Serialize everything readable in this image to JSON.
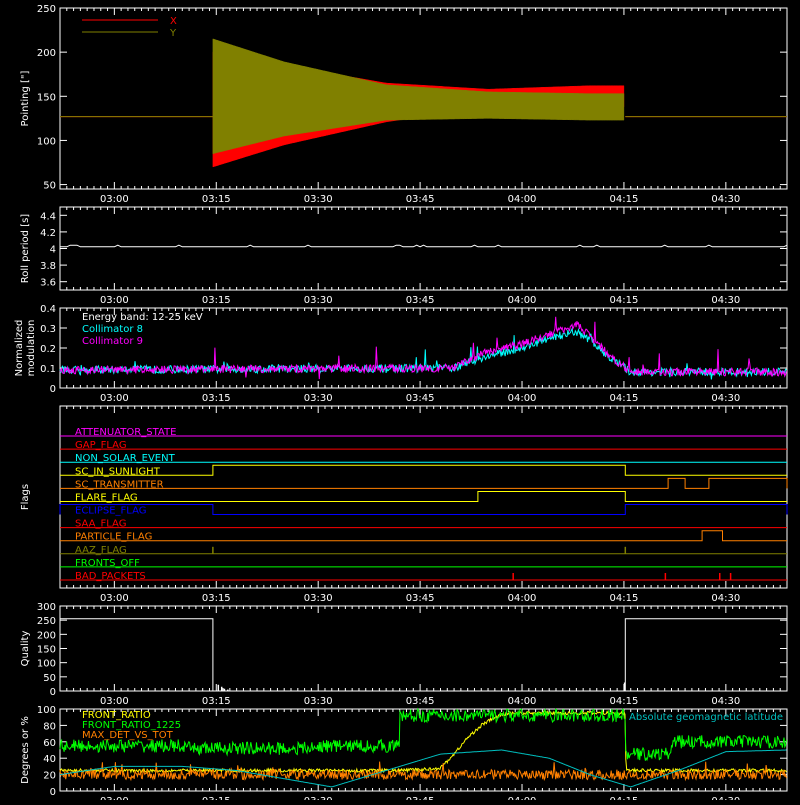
{
  "time_axis": {
    "tick_labels": [
      "03:00",
      "03:15",
      "03:30",
      "03:45",
      "04:00",
      "04:15",
      "04:30"
    ],
    "tick_minutes": [
      180,
      195,
      210,
      225,
      240,
      255,
      270
    ],
    "range_minutes": [
      172,
      279
    ]
  },
  "chart_data": [
    {
      "type": "line",
      "ylabel": "Pointing [\"]",
      "ylim": [
        45,
        250
      ],
      "yticks": [
        50,
        100,
        150,
        200,
        250
      ],
      "legend_position": "top-left",
      "series": [
        {
          "name": "X",
          "color": "#ff0000",
          "baseline": 127,
          "active_window_minutes": [
            194.5,
            255.2
          ],
          "center": {
            "x": [
              194.5,
              205,
              220,
              235,
              250,
              255
            ],
            "y": [
              135,
              140,
              143,
              148,
              150,
              150
            ]
          },
          "amplitude": {
            "x": [
              194.5,
              205,
              220,
              235,
              250,
              255
            ],
            "y": [
              65,
              45,
              22,
              10,
              12,
              12
            ]
          }
        },
        {
          "name": "Y",
          "color": "#808000",
          "baseline": 127,
          "active_window_minutes": [
            194.5,
            255.2
          ],
          "center": {
            "x": [
              194.5,
              205,
              220,
              235,
              250,
              255
            ],
            "y": [
              150,
              147,
              143,
              140,
              138,
              138
            ]
          },
          "amplitude": {
            "x": [
              194.5,
              205,
              220,
              235,
              250,
              255
            ],
            "y": [
              65,
              42,
              20,
              15,
              15,
              15
            ]
          }
        }
      ]
    },
    {
      "type": "line",
      "ylabel": "Roll period [s]",
      "ylim": [
        3.5,
        4.5
      ],
      "yticks": [
        3.6,
        3.8,
        4.0,
        4.2,
        4.4
      ],
      "series": [
        {
          "name": "",
          "color": "#ffffff",
          "y": 4.02
        }
      ]
    },
    {
      "type": "line",
      "ylabel": "Normalized modulation",
      "ylim": [
        0,
        0.4
      ],
      "yticks": [
        0.0,
        0.1,
        0.2,
        0.3,
        0.4
      ],
      "annotation": "Energy band: 12-25 keV",
      "series": [
        {
          "name": "Collimator 8",
          "color": "#00ffff",
          "profile": {
            "x": [
              172,
              230,
              234,
              240,
              245,
              248,
              250,
              253,
              256,
              279
            ],
            "y": [
              0.09,
              0.1,
              0.15,
              0.2,
              0.26,
              0.28,
              0.24,
              0.15,
              0.08,
              0.08
            ]
          }
        },
        {
          "name": "Collimator 9",
          "color": "#ff00ff",
          "profile": {
            "x": [
              172,
              230,
              234,
              240,
              245,
              248,
              250,
              253,
              256,
              279
            ],
            "y": [
              0.09,
              0.1,
              0.17,
              0.22,
              0.28,
              0.32,
              0.26,
              0.16,
              0.08,
              0.08
            ]
          }
        }
      ]
    },
    {
      "type": "line",
      "ylabel": "Flags",
      "series": [
        {
          "name": "ATTENUATOR_STATE",
          "color": "#ff00ff",
          "on_intervals": []
        },
        {
          "name": "GAP_FLAG",
          "color": "#ff0000",
          "on_intervals": []
        },
        {
          "name": "NON_SOLAR_EVENT",
          "color": "#00ffff",
          "on_intervals": []
        },
        {
          "name": "SC_IN_SUNLIGHT",
          "color": "#ffff00",
          "on_intervals": [
            [
              194.5,
              255.2
            ]
          ]
        },
        {
          "name": "SC_TRANSMITTER",
          "color": "#ff8000",
          "on_intervals": [
            [
              261.5,
              264.0
            ],
            [
              267.5,
              279
            ]
          ]
        },
        {
          "name": "FLARE_FLAG",
          "color": "#ffff00",
          "on_intervals": [
            [
              233.5,
              255.2
            ]
          ]
        },
        {
          "name": "ECLIPSE_FLAG",
          "color": "#0000ff",
          "on_intervals": [
            [
              172,
              194.5
            ],
            [
              255.2,
              279
            ]
          ]
        },
        {
          "name": "SAA_FLAG",
          "color": "#ff0000",
          "on_intervals": []
        },
        {
          "name": "PARTICLE_FLAG",
          "color": "#ff8000",
          "on_intervals": [
            [
              266.5,
              269.5
            ]
          ]
        },
        {
          "name": "AAZ_FLAG",
          "color": "#808000",
          "spikes": [
            194.5,
            255.2
          ]
        },
        {
          "name": "FRONTS_OFF",
          "color": "#00ff00",
          "on_intervals": []
        },
        {
          "name": "BAD_PACKETS",
          "color": "#ff0000",
          "spikes": [
            238.7,
            261.1,
            269.1,
            270.7
          ]
        }
      ]
    },
    {
      "type": "line",
      "ylabel": "Quality",
      "ylim": [
        0,
        300
      ],
      "yticks": [
        0,
        50,
        100,
        150,
        200,
        250,
        300
      ],
      "series": [
        {
          "name": "",
          "color": "#ffffff",
          "steps": [
            [
              172,
              194.5,
              255
            ],
            [
              194.5,
              255.2,
              0
            ],
            [
              255.2,
              279,
              255
            ]
          ],
          "spikes": [
            [
              195.3,
              22
            ],
            [
              195.8,
              15
            ],
            [
              196.2,
              8
            ],
            [
              196.7,
              5
            ],
            [
              255.1,
              30
            ]
          ]
        }
      ]
    },
    {
      "type": "line",
      "ylabel": "Degrees or %",
      "ylim": [
        0,
        100
      ],
      "yticks": [
        0,
        20,
        40,
        60,
        80,
        100
      ],
      "series": [
        {
          "name": "FRONT_RATIO",
          "color": "#ffff00",
          "profile": {
            "x": [
              172,
              222,
              225,
              228,
              230,
              232,
              234,
              236,
              238,
              255.2,
              255.3,
              279
            ],
            "y": [
              25,
              25,
              26,
              28,
              45,
              65,
              80,
              90,
              95,
              95,
              25,
              25
            ]
          }
        },
        {
          "name": "FRONT_RATIO_1225",
          "color": "#00ff00",
          "levels": [
            [
              172,
              190,
              55
            ],
            [
              190,
              210,
              52
            ],
            [
              210,
              222,
              55
            ],
            [
              222,
              255.2,
              92
            ],
            [
              255.2,
              262,
              45
            ],
            [
              262,
              279,
              60
            ]
          ]
        },
        {
          "name": "MAX_DET_VS_TOT",
          "color": "#ff8000",
          "level": 20
        },
        {
          "name": "Absolute geomagnetic latitude",
          "color": "#00bfbf",
          "profile": {
            "x": [
              172,
              180,
              190,
              198,
              205,
              212,
              220,
              228,
              237,
              244,
              250,
              256,
              263,
              270,
              279
            ],
            "y": [
              20,
              30,
              30,
              25,
              15,
              5,
              25,
              45,
              50,
              40,
              20,
              5,
              25,
              48,
              50
            ]
          }
        }
      ]
    }
  ]
}
